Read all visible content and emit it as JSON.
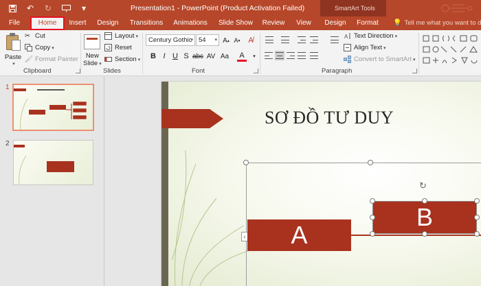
{
  "titlebar": {
    "title": "Presentation1 - PowerPoint (Product Activation Failed)",
    "contextual_title": "SmartArt Tools",
    "accent_color": "#b7472a"
  },
  "tabs": [
    {
      "label": "File"
    },
    {
      "label": "Home"
    },
    {
      "label": "Insert"
    },
    {
      "label": "Design"
    },
    {
      "label": "Transitions"
    },
    {
      "label": "Animations"
    },
    {
      "label": "Slide Show"
    },
    {
      "label": "Review"
    },
    {
      "label": "View"
    },
    {
      "label": "Design"
    },
    {
      "label": "Format"
    }
  ],
  "tell_me": "Tell me what you want to do...",
  "clipboard": {
    "paste": "Paste",
    "cut": "Cut",
    "copy": "Copy",
    "format_painter": "Format Painter",
    "label": "Clipboard"
  },
  "slides_group": {
    "new_slide": "New",
    "new_slide_2": "Slide",
    "layout": "Layout",
    "reset": "Reset",
    "section": "Section",
    "label": "Slides"
  },
  "font": {
    "family": "Century Gothic",
    "size": "54",
    "label": "Font"
  },
  "paragraph": {
    "text_direction": "Text Direction",
    "align_text": "Align Text",
    "convert_smartart": "Convert to SmartArt",
    "label": "Paragraph"
  },
  "thumbnails": [
    {
      "number": "1"
    },
    {
      "number": "2"
    }
  ],
  "slide": {
    "title": "SƠ ĐỒ TƯ DUY",
    "box_a": "A",
    "box_b": "B",
    "shape_color": "#a8321e"
  }
}
